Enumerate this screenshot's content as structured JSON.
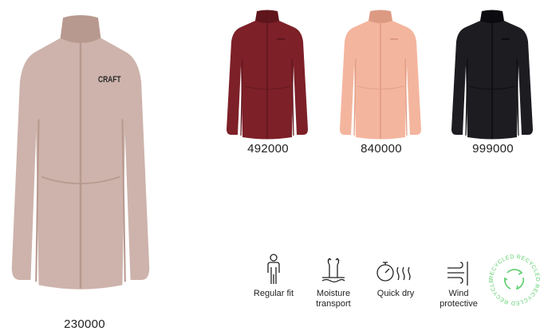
{
  "product": {
    "main": {
      "code": "230000",
      "color": "#cdb3ab",
      "shadow": "#b8998f",
      "brand": "CRAFT"
    },
    "variants": [
      {
        "code": "492000",
        "color": "#7d2028",
        "shadow": "#5f151c"
      },
      {
        "code": "840000",
        "color": "#f4b59e",
        "shadow": "#dd9a83"
      },
      {
        "code": "999000",
        "color": "#1d1c21",
        "shadow": "#0c0b0f"
      }
    ]
  },
  "features": [
    {
      "icon": "person-icon",
      "label": "Regular fit"
    },
    {
      "icon": "moisture-transport-icon",
      "label": "Moisture\ntransport"
    },
    {
      "icon": "quick-dry-icon",
      "label": "Quick dry"
    },
    {
      "icon": "wind-protective-icon",
      "label": "Wind\nprotective"
    }
  ],
  "badge": {
    "icon": "recycled-icon",
    "text": "RECYCLED RECYCLED RECYCLED RECYCLED",
    "color": "#5fcf6f"
  }
}
